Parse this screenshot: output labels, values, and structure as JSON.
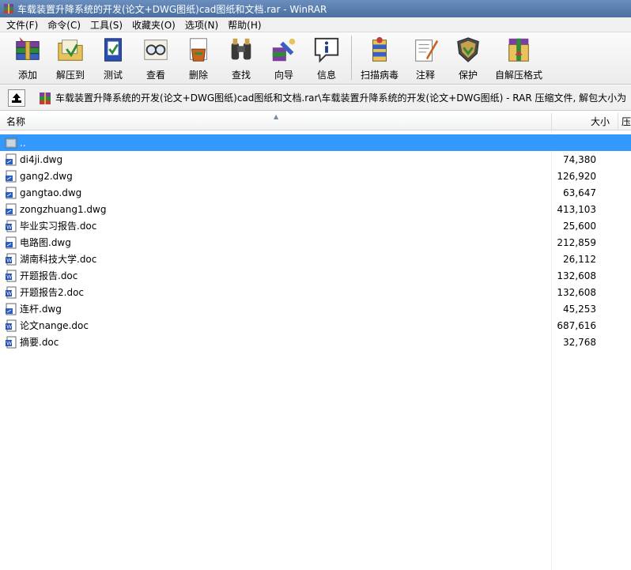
{
  "window": {
    "title": "车载装置升降系统的开发(论文+DWG图纸)cad图纸和文档.rar - WinRAR"
  },
  "menu": [
    "文件(F)",
    "命令(C)",
    "工具(S)",
    "收藏夹(O)",
    "选项(N)",
    "帮助(H)"
  ],
  "toolbar": {
    "add": "添加",
    "extract": "解压到",
    "test": "测试",
    "view": "查看",
    "delete": "删除",
    "find": "查找",
    "wizard": "向导",
    "info": "信息",
    "virus_scan": "扫描病毒",
    "comment": "注释",
    "protect": "保护",
    "sfx": "自解压格式"
  },
  "pathbar": {
    "path": "车载装置升降系统的开发(论文+DWG图纸)cad图纸和文档.rar\\车载装置升降系统的开发(论文+DWG图纸) - RAR 压缩文件, 解包大小为"
  },
  "columns": {
    "name": "名称",
    "size": "大小",
    "extra": "压"
  },
  "files": [
    {
      "name": "..",
      "size": "",
      "icon": "folder-up-icon"
    },
    {
      "name": "di4ji.dwg",
      "size": "74,380",
      "icon": "dwg-file-icon"
    },
    {
      "name": "gang2.dwg",
      "size": "126,920",
      "icon": "dwg-file-icon"
    },
    {
      "name": "gangtao.dwg",
      "size": "63,647",
      "icon": "dwg-file-icon"
    },
    {
      "name": "zongzhuang1.dwg",
      "size": "413,103",
      "icon": "dwg-file-icon"
    },
    {
      "name": "毕业实习报告.doc",
      "size": "25,600",
      "icon": "word-doc-icon"
    },
    {
      "name": "电路图.dwg",
      "size": "212,859",
      "icon": "dwg-file-icon"
    },
    {
      "name": "湖南科技大学.doc",
      "size": "26,112",
      "icon": "word-doc-icon"
    },
    {
      "name": "开题报告.doc",
      "size": "132,608",
      "icon": "word-doc-icon"
    },
    {
      "name": "开题报告2.doc",
      "size": "132,608",
      "icon": "word-doc-icon"
    },
    {
      "name": "连杆.dwg",
      "size": "45,253",
      "icon": "dwg-file-icon"
    },
    {
      "name": "论文nange.doc",
      "size": "687,616",
      "icon": "word-doc-icon"
    },
    {
      "name": "摘要.doc",
      "size": "32,768",
      "icon": "word-doc-icon"
    }
  ],
  "selected_index": 0,
  "colors": {
    "selection": "#3399ff",
    "titlebar": "#5a7fb0"
  }
}
